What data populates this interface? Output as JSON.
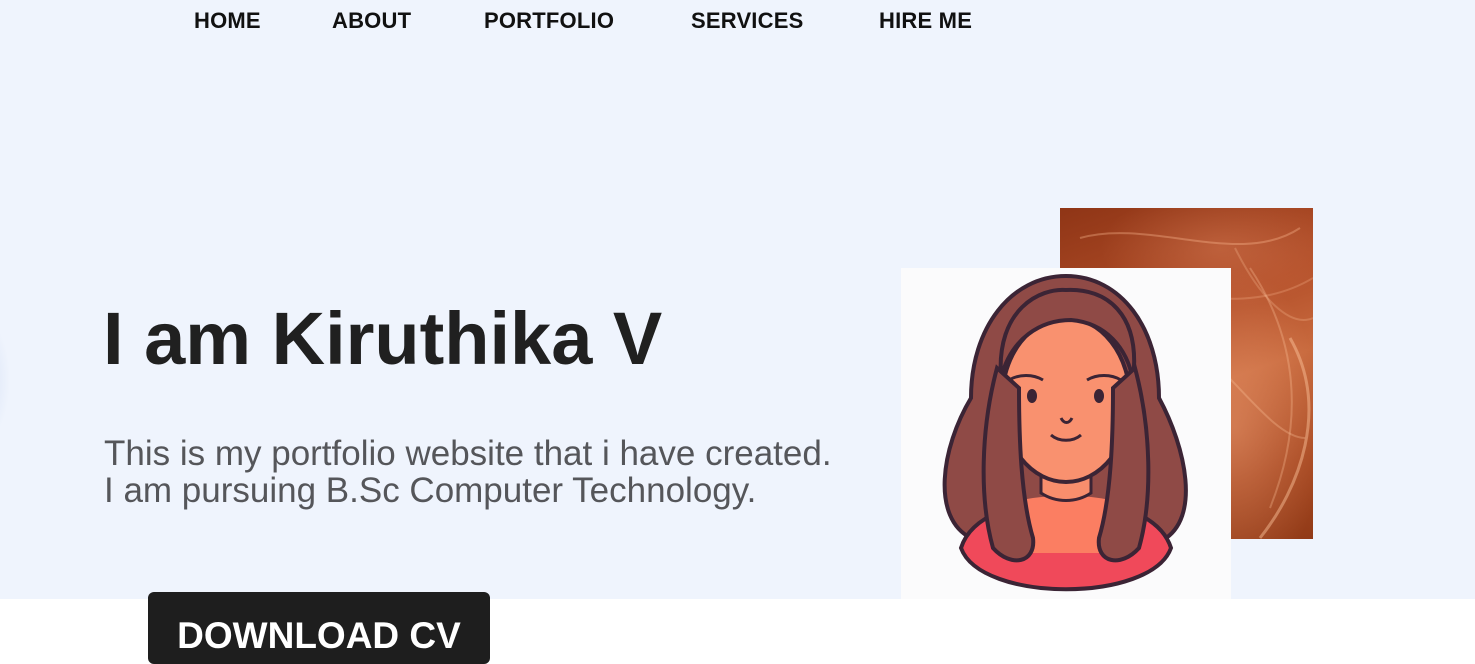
{
  "nav": {
    "items": [
      {
        "label": "HOME"
      },
      {
        "label": "ABOUT"
      },
      {
        "label": "PORTFOLIO"
      },
      {
        "label": "SERVICES"
      },
      {
        "label": "HIRE ME"
      }
    ]
  },
  "hero": {
    "headline": "I am Kiruthika V",
    "intro_line_1": "This is my portfolio website that i have created.",
    "intro_line_2": "I am pursuing B.Sc Computer Technology.",
    "download_label": "DOWNLOAD CV"
  },
  "colors": {
    "hero_background": "#eff4fd",
    "button_background": "#1e1e1e",
    "backdrop_accent": "#b4502a"
  },
  "images": {
    "portrait": "cartoon-avatar-girl",
    "backdrop": "orange-abstract-texture"
  }
}
